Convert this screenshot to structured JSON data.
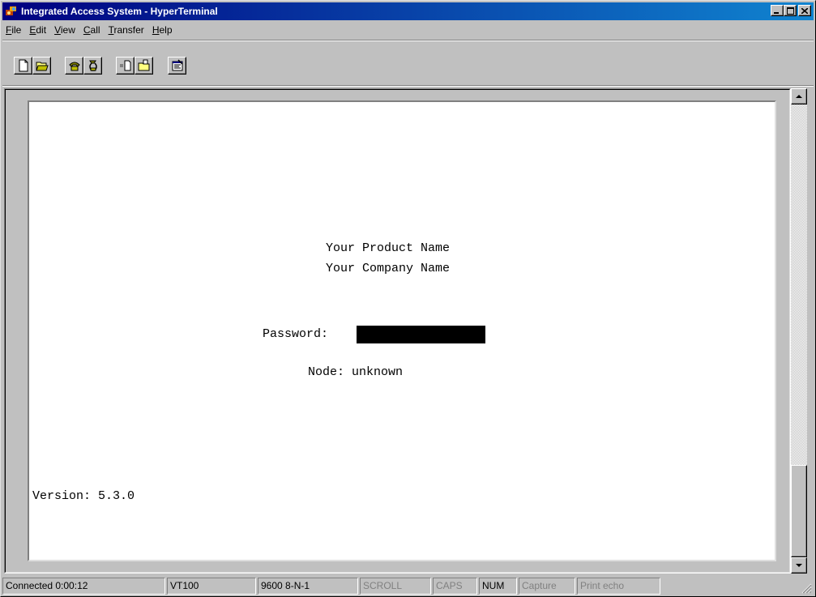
{
  "window": {
    "title": "Integrated Access System - HyperTerminal",
    "minimize_label": "minimize",
    "maximize_label": "maximize",
    "close_label": "close"
  },
  "menu": {
    "items": [
      {
        "label": "File",
        "accel": "F",
        "rest": "ile"
      },
      {
        "label": "Edit",
        "accel": "E",
        "rest": "dit"
      },
      {
        "label": "View",
        "accel": "V",
        "rest": "iew"
      },
      {
        "label": "Call",
        "accel": "C",
        "rest": "all"
      },
      {
        "label": "Transfer",
        "accel": "T",
        "rest": "ransfer"
      },
      {
        "label": "Help",
        "accel": "H",
        "rest": "elp"
      }
    ]
  },
  "toolbar": {
    "buttons": [
      {
        "icon": "new-document-icon"
      },
      {
        "icon": "open-folder-icon"
      },
      {
        "icon": "connect-phone-icon"
      },
      {
        "icon": "disconnect-phone-icon"
      },
      {
        "icon": "send-file-icon"
      },
      {
        "icon": "receive-file-icon"
      },
      {
        "icon": "properties-icon"
      }
    ]
  },
  "terminal": {
    "product_name": "Your Product Name",
    "company_name": "Your Company Name",
    "password_label": "Password:",
    "node_label": "Node: unknown",
    "version": "Version: 5.3.0"
  },
  "status": {
    "connected": "Connected 0:00:12",
    "emulation": "VT100",
    "settings": "9600 8-N-1",
    "scroll": "SCROLL",
    "caps": "CAPS",
    "num": "NUM",
    "capture": "Capture",
    "print_echo": "Print echo"
  },
  "colors": {
    "title_start": "#000080",
    "title_end": "#1084d0",
    "face": "#c0c0c0",
    "terminal_bg": "#ffffff"
  }
}
